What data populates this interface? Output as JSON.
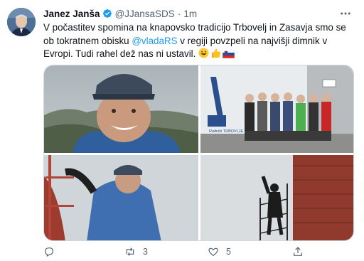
{
  "author": {
    "name": "Janez Janša",
    "handle": "@JJansaSDS",
    "separator": "·",
    "time": "1m"
  },
  "tweet_text": {
    "part1": "V počastitev spomina na knapovsko tradicijo Trbovelj in Zasavja smo se ob tokratnem obisku ",
    "mention": "@vladaRS",
    "part2": " v regiji povzpeli na najvišji dimnik v Evropi. Tudi rahel dež nas ni ustavil.",
    "emojis": [
      "grinning-face-emoji",
      "thumbs-up-emoji",
      "slovenia-flag-emoji"
    ]
  },
  "media": {
    "photo2_sign": "Rudniki TRBOVLJE"
  },
  "actions": {
    "reply_count": "",
    "retweet_count": "3",
    "like_count": "5"
  },
  "colors": {
    "accent": "#1d9bf0",
    "secondary_text": "#536471",
    "border": "#cfd9de"
  }
}
